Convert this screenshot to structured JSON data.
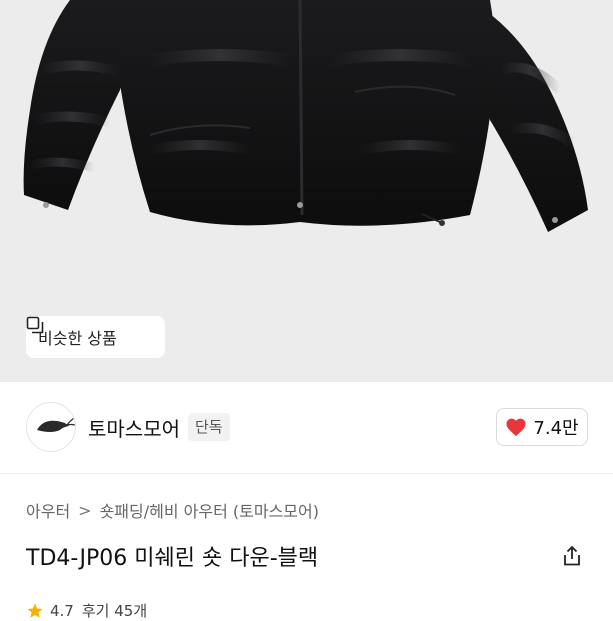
{
  "hero": {
    "similar_button_label": "비슷한 상품"
  },
  "store": {
    "logo_text": "THOMAS MORE",
    "name": "토마스모어",
    "badge": "단독",
    "like_count": "7.4만"
  },
  "breadcrumb": {
    "items": [
      "아우터",
      "숏패딩/헤비 아우터 (토마스모어)"
    ],
    "separator": ">"
  },
  "product": {
    "title": "TD4-JP06 미쉐린 숏 다운-블랙",
    "rating": "4.7",
    "review_text": "후기 45개"
  },
  "colors": {
    "accent_red": "#e8363c",
    "star_yellow": "#f5b400"
  }
}
